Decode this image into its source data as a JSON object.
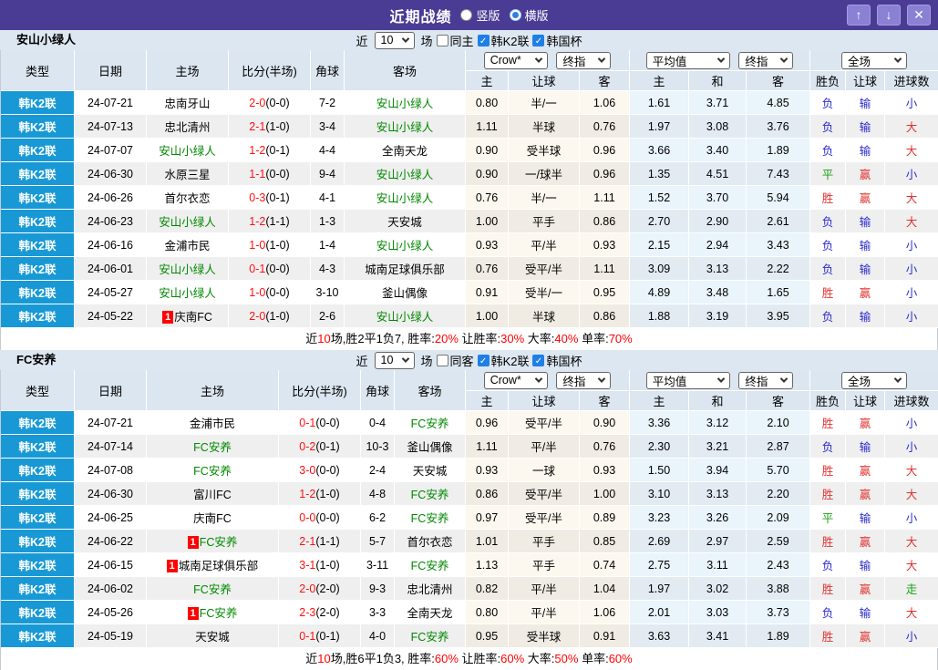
{
  "window": {
    "title": "近期战绩",
    "radios": [
      {
        "label": "竖版",
        "selected": false
      },
      {
        "label": "横版",
        "selected": true
      }
    ],
    "buttons": [
      {
        "name": "up",
        "glyph": "↑"
      },
      {
        "name": "down",
        "glyph": "↓"
      },
      {
        "name": "close",
        "glyph": "✕"
      }
    ]
  },
  "filter": {
    "near": "近",
    "count": "10",
    "games": "场"
  },
  "columns": {
    "main": [
      "类型",
      "日期",
      "主场",
      "比分(半场)",
      "角球",
      "客场"
    ],
    "sub": [
      "主",
      "让球",
      "客",
      "主",
      "和",
      "客",
      "胜负",
      "让球",
      "进球数"
    ],
    "dropdowns": {
      "book": "Crow*",
      "final1": "终指",
      "avg": "平均值",
      "final2": "终指",
      "scope": "全场"
    }
  },
  "result_colors": {
    "胜": "#e03232",
    "平": "#18a018",
    "负": "#2a2ad0",
    "赢": "#e03232",
    "输": "#2a2ad0",
    "大": "#e03232",
    "小": "#2a2ad0",
    "走": "#18a018"
  },
  "colors": {
    "titlebar": "#4a3c94",
    "type_cell": "#1899d5",
    "header_bg": "#dce6f0",
    "filter_bg": "#dde7f1",
    "team_green": "#008800",
    "score_red": "#ff1010"
  },
  "sections": [
    {
      "team": "安山小绿人",
      "checkboxes": [
        {
          "label": "同主",
          "checked": false
        },
        {
          "label": "韩K2联",
          "checked": true
        },
        {
          "label": "韩国杯",
          "checked": true
        }
      ],
      "rows": [
        {
          "league": "韩K2联",
          "date": "24-07-21",
          "home": "忠南牙山",
          "home_badge": false,
          "home_green": false,
          "score": "2-0",
          "half": "(0-0)",
          "corners": "7-2",
          "away": "安山小绿人",
          "away_green": true,
          "odds": [
            "0.80",
            "半/一",
            "1.06"
          ],
          "avg": [
            "1.61",
            "3.71",
            "4.85"
          ],
          "results": [
            "负",
            "输",
            "小"
          ]
        },
        {
          "league": "韩K2联",
          "date": "24-07-13",
          "home": "忠北清州",
          "home_badge": false,
          "home_green": false,
          "score": "2-1",
          "half": "(1-0)",
          "corners": "3-4",
          "away": "安山小绿人",
          "away_green": true,
          "odds": [
            "1.11",
            "半球",
            "0.76"
          ],
          "avg": [
            "1.97",
            "3.08",
            "3.76"
          ],
          "results": [
            "负",
            "输",
            "大"
          ]
        },
        {
          "league": "韩K2联",
          "date": "24-07-07",
          "home": "安山小绿人",
          "home_badge": false,
          "home_green": true,
          "score": "1-2",
          "half": "(0-1)",
          "corners": "4-4",
          "away": "全南天龙",
          "away_green": false,
          "odds": [
            "0.90",
            "受半球",
            "0.96"
          ],
          "avg": [
            "3.66",
            "3.40",
            "1.89"
          ],
          "results": [
            "负",
            "输",
            "大"
          ]
        },
        {
          "league": "韩K2联",
          "date": "24-06-30",
          "home": "水原三星",
          "home_badge": false,
          "home_green": false,
          "score": "1-1",
          "half": "(0-0)",
          "corners": "9-4",
          "away": "安山小绿人",
          "away_green": true,
          "odds": [
            "0.90",
            "一/球半",
            "0.96"
          ],
          "avg": [
            "1.35",
            "4.51",
            "7.43"
          ],
          "results": [
            "平",
            "赢",
            "小"
          ]
        },
        {
          "league": "韩K2联",
          "date": "24-06-26",
          "home": "首尔衣恋",
          "home_badge": false,
          "home_green": false,
          "score": "0-3",
          "half": "(0-1)",
          "corners": "4-1",
          "away": "安山小绿人",
          "away_green": true,
          "odds": [
            "0.76",
            "半/一",
            "1.11"
          ],
          "avg": [
            "1.52",
            "3.70",
            "5.94"
          ],
          "results": [
            "胜",
            "赢",
            "大"
          ]
        },
        {
          "league": "韩K2联",
          "date": "24-06-23",
          "home": "安山小绿人",
          "home_badge": false,
          "home_green": true,
          "score": "1-2",
          "half": "(1-1)",
          "corners": "1-3",
          "away": "天安城",
          "away_green": false,
          "odds": [
            "1.00",
            "平手",
            "0.86"
          ],
          "avg": [
            "2.70",
            "2.90",
            "2.61"
          ],
          "results": [
            "负",
            "输",
            "大"
          ]
        },
        {
          "league": "韩K2联",
          "date": "24-06-16",
          "home": "金浦市民",
          "home_badge": false,
          "home_green": false,
          "score": "1-0",
          "half": "(1-0)",
          "corners": "1-4",
          "away": "安山小绿人",
          "away_green": true,
          "odds": [
            "0.93",
            "平/半",
            "0.93"
          ],
          "avg": [
            "2.15",
            "2.94",
            "3.43"
          ],
          "results": [
            "负",
            "输",
            "小"
          ]
        },
        {
          "league": "韩K2联",
          "date": "24-06-01",
          "home": "安山小绿人",
          "home_badge": false,
          "home_green": true,
          "score": "0-1",
          "half": "(0-0)",
          "corners": "4-3",
          "away": "城南足球俱乐部",
          "away_green": false,
          "odds": [
            "0.76",
            "受平/半",
            "1.11"
          ],
          "avg": [
            "3.09",
            "3.13",
            "2.22"
          ],
          "results": [
            "负",
            "输",
            "小"
          ]
        },
        {
          "league": "韩K2联",
          "date": "24-05-27",
          "home": "安山小绿人",
          "home_badge": false,
          "home_green": true,
          "score": "1-0",
          "half": "(0-0)",
          "corners": "3-10",
          "away": "釜山偶像",
          "away_green": false,
          "odds": [
            "0.91",
            "受半/一",
            "0.95"
          ],
          "avg": [
            "4.89",
            "3.48",
            "1.65"
          ],
          "results": [
            "胜",
            "赢",
            "小"
          ]
        },
        {
          "league": "韩K2联",
          "date": "24-05-22",
          "home": "庆南FC",
          "home_badge": true,
          "home_green": false,
          "score": "2-0",
          "half": "(1-0)",
          "corners": "2-6",
          "away": "安山小绿人",
          "away_green": true,
          "odds": [
            "1.00",
            "半球",
            "0.86"
          ],
          "avg": [
            "1.88",
            "3.19",
            "3.95"
          ],
          "results": [
            "负",
            "输",
            "小"
          ]
        }
      ],
      "summary": [
        [
          "近",
          false
        ],
        [
          "10",
          true
        ],
        [
          "场,胜2平1负7, 胜率:",
          false
        ],
        [
          "20%",
          true
        ],
        [
          " 让胜率:",
          false
        ],
        [
          "30%",
          true
        ],
        [
          " 大率:",
          false
        ],
        [
          "40%",
          true
        ],
        [
          " 单率:",
          false
        ],
        [
          "70%",
          true
        ]
      ]
    },
    {
      "team": "FC安养",
      "checkboxes": [
        {
          "label": "同客",
          "checked": false
        },
        {
          "label": "韩K2联",
          "checked": true
        },
        {
          "label": "韩国杯",
          "checked": true
        }
      ],
      "rows": [
        {
          "league": "韩K2联",
          "date": "24-07-21",
          "home": "金浦市民",
          "home_badge": false,
          "home_green": false,
          "score": "0-1",
          "half": "(0-0)",
          "corners": "0-4",
          "away": "FC安养",
          "away_green": true,
          "odds": [
            "0.96",
            "受平/半",
            "0.90"
          ],
          "avg": [
            "3.36",
            "3.12",
            "2.10"
          ],
          "results": [
            "胜",
            "赢",
            "小"
          ]
        },
        {
          "league": "韩K2联",
          "date": "24-07-14",
          "home": "FC安养",
          "home_badge": false,
          "home_green": true,
          "score": "0-2",
          "half": "(0-1)",
          "corners": "10-3",
          "away": "釜山偶像",
          "away_green": false,
          "odds": [
            "1.11",
            "平/半",
            "0.76"
          ],
          "avg": [
            "2.30",
            "3.21",
            "2.87"
          ],
          "results": [
            "负",
            "输",
            "小"
          ]
        },
        {
          "league": "韩K2联",
          "date": "24-07-08",
          "home": "FC安养",
          "home_badge": false,
          "home_green": true,
          "score": "3-0",
          "half": "(0-0)",
          "corners": "2-4",
          "away": "天安城",
          "away_green": false,
          "odds": [
            "0.93",
            "一球",
            "0.93"
          ],
          "avg": [
            "1.50",
            "3.94",
            "5.70"
          ],
          "results": [
            "胜",
            "赢",
            "大"
          ]
        },
        {
          "league": "韩K2联",
          "date": "24-06-30",
          "home": "富川FC",
          "home_badge": false,
          "home_green": false,
          "score": "1-2",
          "half": "(1-0)",
          "corners": "4-8",
          "away": "FC安养",
          "away_green": true,
          "odds": [
            "0.86",
            "受平/半",
            "1.00"
          ],
          "avg": [
            "3.10",
            "3.13",
            "2.20"
          ],
          "results": [
            "胜",
            "赢",
            "大"
          ]
        },
        {
          "league": "韩K2联",
          "date": "24-06-25",
          "home": "庆南FC",
          "home_badge": false,
          "home_green": false,
          "score": "0-0",
          "half": "(0-0)",
          "corners": "6-2",
          "away": "FC安养",
          "away_green": true,
          "odds": [
            "0.97",
            "受平/半",
            "0.89"
          ],
          "avg": [
            "3.23",
            "3.26",
            "2.09"
          ],
          "results": [
            "平",
            "输",
            "小"
          ]
        },
        {
          "league": "韩K2联",
          "date": "24-06-22",
          "home": "FC安养",
          "home_badge": true,
          "home_green": true,
          "score": "2-1",
          "half": "(1-1)",
          "corners": "5-7",
          "away": "首尔衣恋",
          "away_green": false,
          "odds": [
            "1.01",
            "平手",
            "0.85"
          ],
          "avg": [
            "2.69",
            "2.97",
            "2.59"
          ],
          "results": [
            "胜",
            "赢",
            "大"
          ]
        },
        {
          "league": "韩K2联",
          "date": "24-06-15",
          "home": "城南足球俱乐部",
          "home_badge": true,
          "home_green": false,
          "score": "3-1",
          "half": "(1-0)",
          "corners": "3-11",
          "away": "FC安养",
          "away_green": true,
          "odds": [
            "1.13",
            "平手",
            "0.74"
          ],
          "avg": [
            "2.75",
            "3.11",
            "2.43"
          ],
          "results": [
            "负",
            "输",
            "大"
          ]
        },
        {
          "league": "韩K2联",
          "date": "24-06-02",
          "home": "FC安养",
          "home_badge": false,
          "home_green": true,
          "score": "2-0",
          "half": "(2-0)",
          "corners": "9-3",
          "away": "忠北清州",
          "away_green": false,
          "odds": [
            "0.82",
            "平/半",
            "1.04"
          ],
          "avg": [
            "1.97",
            "3.02",
            "3.88"
          ],
          "results": [
            "胜",
            "赢",
            "走"
          ]
        },
        {
          "league": "韩K2联",
          "date": "24-05-26",
          "home": "FC安养",
          "home_badge": true,
          "home_green": true,
          "score": "2-3",
          "half": "(2-0)",
          "corners": "3-3",
          "away": "全南天龙",
          "away_green": false,
          "odds": [
            "0.80",
            "平/半",
            "1.06"
          ],
          "avg": [
            "2.01",
            "3.03",
            "3.73"
          ],
          "results": [
            "负",
            "输",
            "大"
          ]
        },
        {
          "league": "韩K2联",
          "date": "24-05-19",
          "home": "天安城",
          "home_badge": false,
          "home_green": false,
          "score": "0-1",
          "half": "(0-1)",
          "corners": "4-0",
          "away": "FC安养",
          "away_green": true,
          "odds": [
            "0.95",
            "受半球",
            "0.91"
          ],
          "avg": [
            "3.63",
            "3.41",
            "1.89"
          ],
          "results": [
            "胜",
            "赢",
            "小"
          ]
        }
      ],
      "summary": [
        [
          "近",
          false
        ],
        [
          "10",
          true
        ],
        [
          "场,胜6平1负3, 胜率:",
          false
        ],
        [
          "60%",
          true
        ],
        [
          " 让胜率:",
          false
        ],
        [
          "60%",
          true
        ],
        [
          " 大率:",
          false
        ],
        [
          "50%",
          true
        ],
        [
          " 单率:",
          false
        ],
        [
          "60%",
          true
        ]
      ]
    }
  ]
}
